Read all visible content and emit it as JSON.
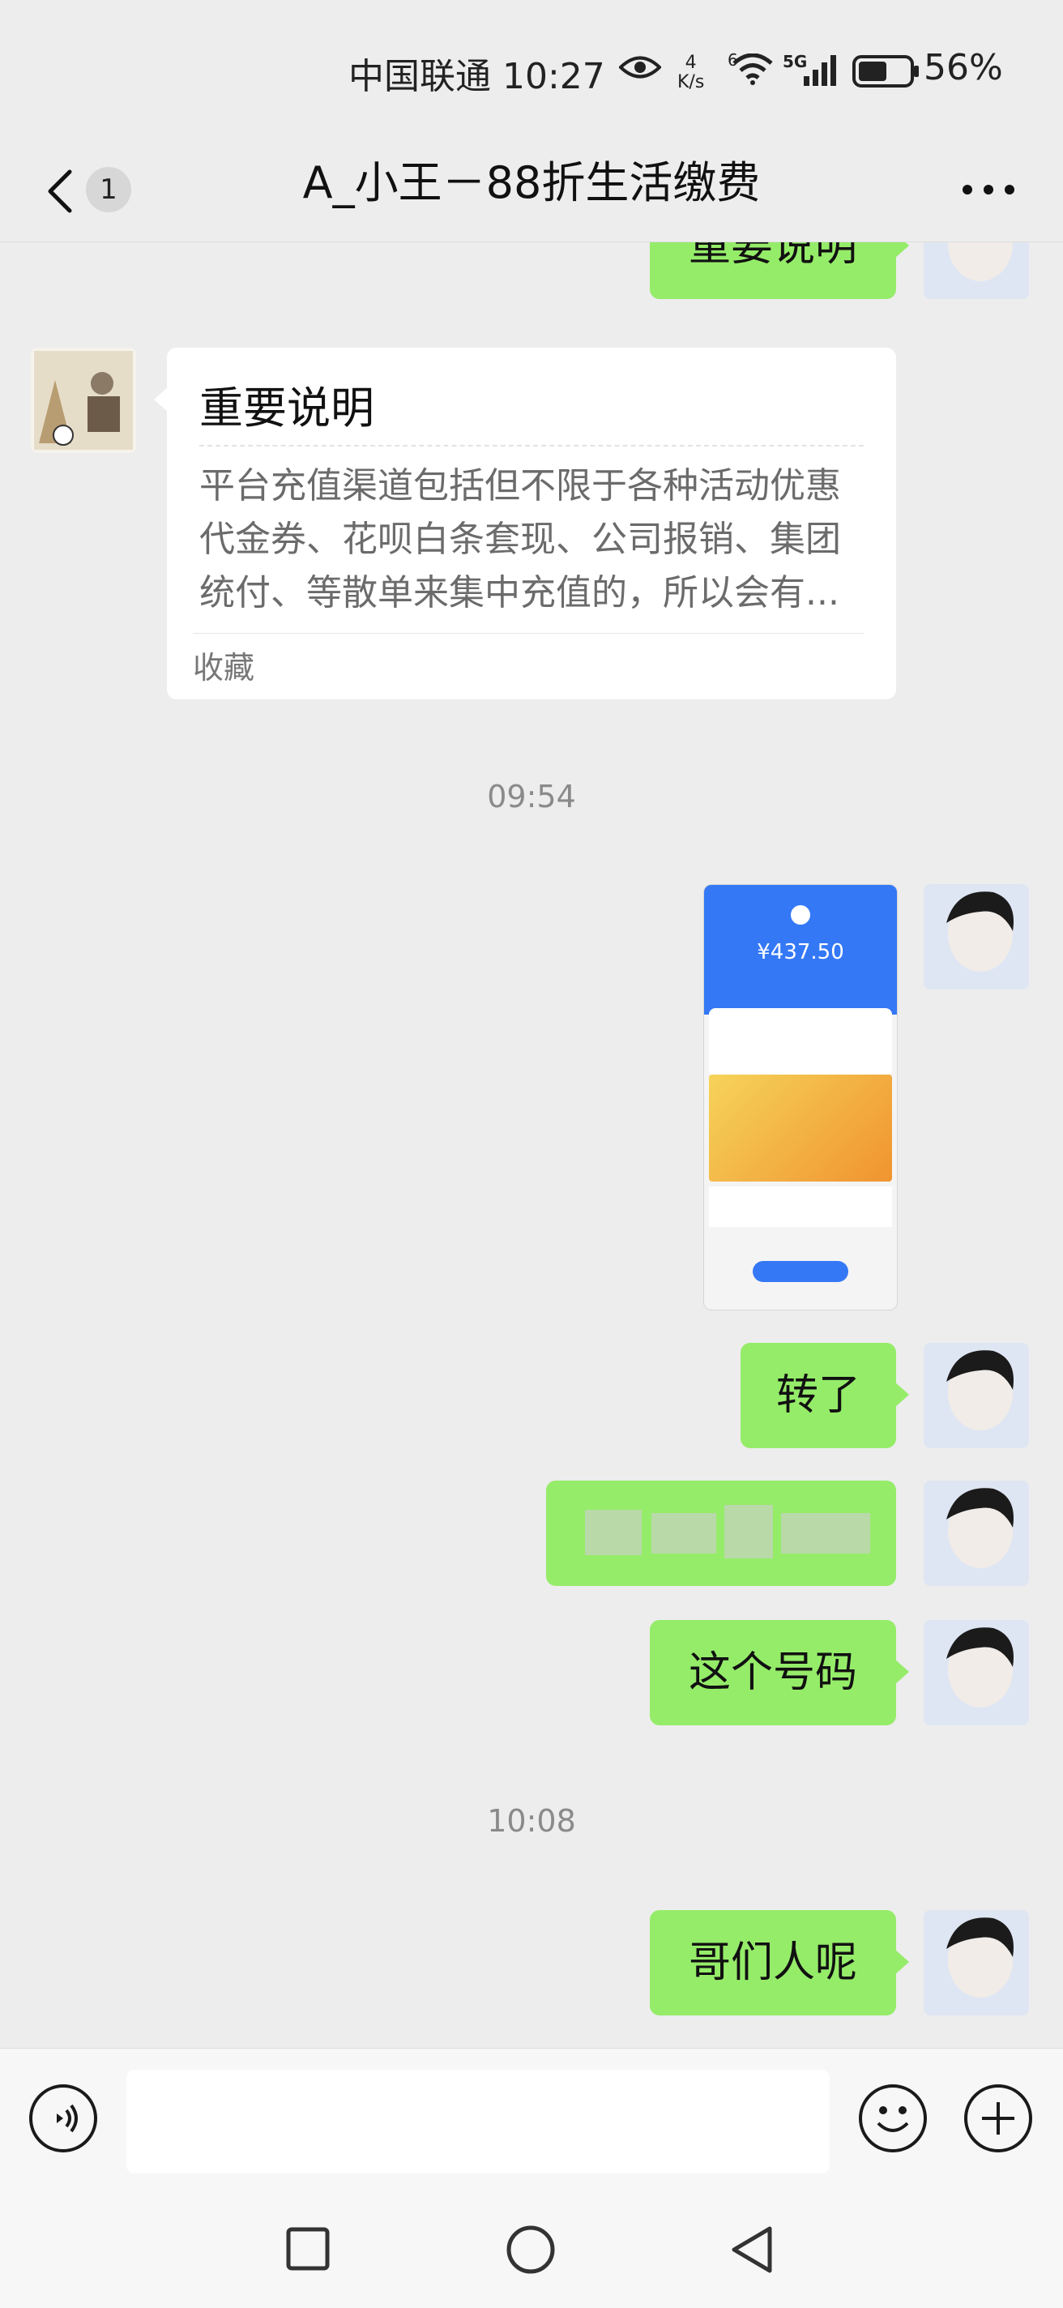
{
  "status_bar": {
    "carrier_time": "中国联通 10:27",
    "net_speed_value": "4",
    "net_speed_unit": "K/s",
    "wifi_label": "6",
    "network_type": "5G",
    "battery_percent": "56%",
    "icons": [
      "eye-icon",
      "wifi-icon",
      "signal-icon",
      "battery-icon"
    ]
  },
  "header": {
    "unread_count": "1",
    "title": "A_小王－88折生活缴费",
    "icons": [
      "back-chevron-icon",
      "more-icon"
    ]
  },
  "messages": {
    "m1_text": "重要说明",
    "card": {
      "title": "重要说明",
      "description": "平台充值渠道包括但不限于各种活动优惠代金券、花呗白条套现、公司报销、集团统付、等散单来集中充值的，所以会有...",
      "footer": "收藏"
    },
    "time1": "09:54",
    "screenshot": {
      "amount": "¥437.50"
    },
    "m2_text": "转了",
    "m4_text": "这个号码",
    "time2": "10:08",
    "m5_text": "哥们人呢"
  },
  "input_bar": {
    "placeholder": "",
    "icons": [
      "voice-icon",
      "emoji-icon",
      "plus-icon"
    ]
  },
  "nav_bar": {
    "icons": [
      "recents-square-icon",
      "home-circle-icon",
      "back-triangle-icon"
    ]
  },
  "colors": {
    "outgoing_bubble": "#95ec69",
    "chat_background": "#ededed",
    "time_text": "#8a8a8a"
  }
}
